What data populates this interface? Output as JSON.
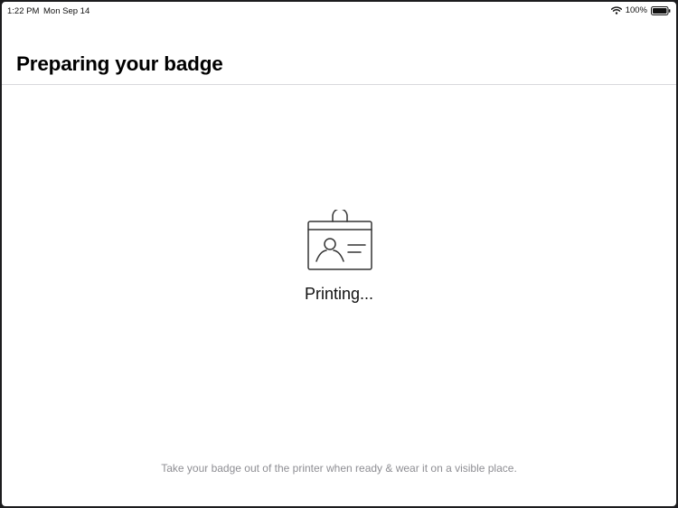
{
  "status_bar": {
    "time": "1:22 PM",
    "date": "Mon Sep 14",
    "battery": "100%",
    "icons": {
      "wifi": "wifi-icon",
      "battery": "battery-icon"
    }
  },
  "header": {
    "title": "Preparing your badge"
  },
  "main": {
    "icon": "badge-icon",
    "status": "Printing...",
    "hint": "Take your badge out of the printer when ready & wear it on a visible place."
  },
  "colors": {
    "background": "#ffffff",
    "title": "#000000",
    "hint": "#8e8e93",
    "divider": "#d9d9dc",
    "icon_stroke": "#333333"
  }
}
